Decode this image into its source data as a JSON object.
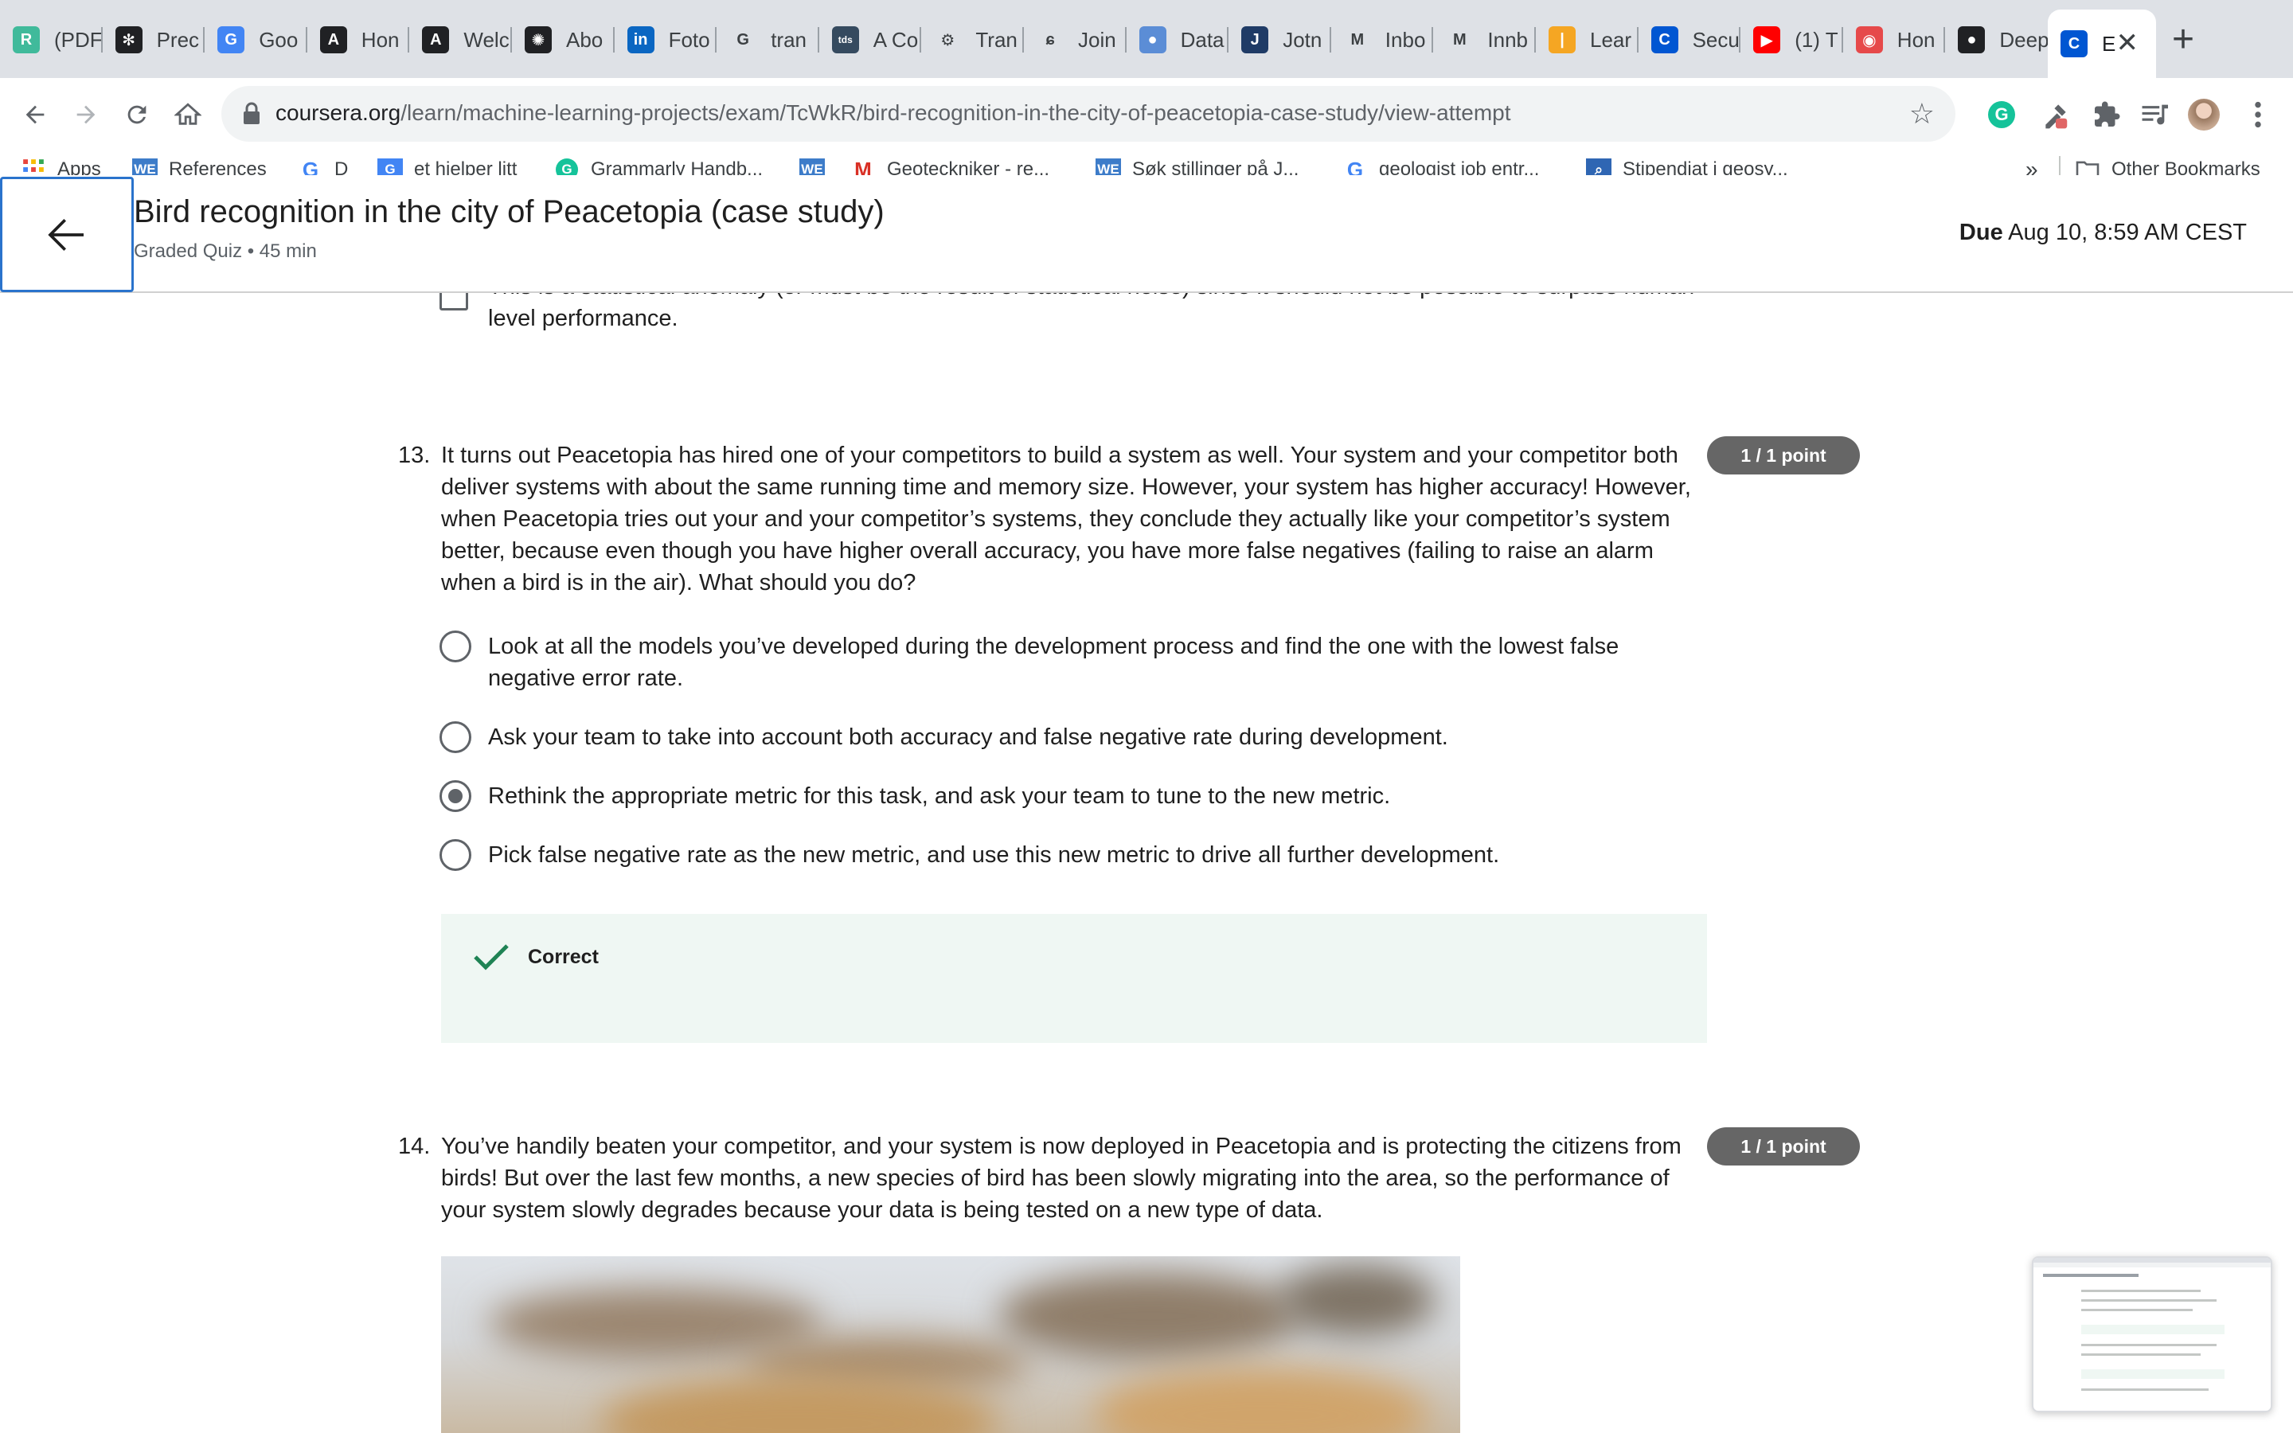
{
  "tabs": [
    {
      "label": "(PDF",
      "icon": "researchgate-icon",
      "color": "#40ba9b",
      "glyph": "R"
    },
    {
      "label": "Prec",
      "icon": "gear-icon",
      "color": "#202124",
      "glyph": "✻"
    },
    {
      "label": "Goo",
      "icon": "google-translate-icon",
      "color": "#4285f4",
      "glyph": "G"
    },
    {
      "label": "Hon",
      "icon": "letter-a-icon",
      "color": "#202124",
      "glyph": "A"
    },
    {
      "label": "Welc",
      "icon": "letter-a-icon",
      "color": "#202124",
      "glyph": "A"
    },
    {
      "label": "Abo",
      "icon": "openai-icon",
      "color": "#202124",
      "glyph": "✺"
    },
    {
      "label": "Foto",
      "icon": "linkedin-icon",
      "color": "#0a66c2",
      "glyph": "in"
    },
    {
      "label": "tran",
      "icon": "google-icon",
      "color": "#ffffff",
      "glyph": "G"
    },
    {
      "label": "A Co",
      "icon": "tds-icon",
      "color": "#354a5f",
      "glyph": "tds"
    },
    {
      "label": "Tran",
      "icon": "drone-icon",
      "color": "#ffffff",
      "glyph": "⚙"
    },
    {
      "label": "Join",
      "icon": "fork-icon",
      "color": "#ffffff",
      "glyph": "ɕ"
    },
    {
      "label": "Data",
      "icon": "person-icon",
      "color": "#5b8dd6",
      "glyph": "●"
    },
    {
      "label": "Jotn",
      "icon": "journal-icon",
      "color": "#1f3b66",
      "glyph": "J"
    },
    {
      "label": "Inbo",
      "icon": "gmail-icon",
      "color": "#ffffff",
      "glyph": "M"
    },
    {
      "label": "Innb",
      "icon": "gmail-icon",
      "color": "#ffffff",
      "glyph": "M"
    },
    {
      "label": "Lear",
      "icon": "bar-icon",
      "color": "#f5a623",
      "glyph": "|"
    },
    {
      "label": "Secu",
      "icon": "coursera-icon",
      "color": "#0056d2",
      "glyph": "C"
    },
    {
      "label": "(1) T",
      "icon": "youtube-icon",
      "color": "#ff0000",
      "glyph": "▶"
    },
    {
      "label": "Hon",
      "icon": "target-icon",
      "color": "#e6494a",
      "glyph": "◉"
    },
    {
      "label": "Deep",
      "icon": "github-icon",
      "color": "#202124",
      "glyph": "●"
    },
    {
      "label": "E",
      "icon": "coursera-icon",
      "color": "#0056d2",
      "glyph": "C"
    }
  ],
  "toolbar": {
    "url_host": "coursera.org",
    "url_path": "/learn/machine-learning-projects/exam/TcWkR/bird-recognition-in-the-city-of-peacetopia-case-study/view-attempt"
  },
  "bookmarks": {
    "items": [
      {
        "label": "Apps",
        "icon": "apps-grid-icon"
      },
      {
        "label": "References",
        "icon": "we-icon"
      },
      {
        "label": "D",
        "icon": "google-icon"
      },
      {
        "label": "et hjelper litt",
        "icon": "google-translate-icon"
      },
      {
        "label": "Grammarly Handb...",
        "icon": "grammarly-icon"
      },
      {
        "label": "",
        "icon": "we-icon"
      },
      {
        "label": "Geoteckniker - re...",
        "icon": "gmail-icon"
      },
      {
        "label": "Søk stillinger på J...",
        "icon": "we-icon"
      },
      {
        "label": "geologist job entr...",
        "icon": "google-icon"
      },
      {
        "label": "Stipendiat i geosy...",
        "icon": "bookmark-blue-icon"
      }
    ],
    "overflow": "»",
    "other": "Other Bookmarks"
  },
  "header": {
    "title": "Bird recognition in the city of Peacetopia (case study)",
    "subtitle": "Graded Quiz • 45 min",
    "due_label": "Due",
    "due_value": "Aug 10, 8:59 AM CEST"
  },
  "prev_option": {
    "text": "This is a statistical anomaly (or must be the result of statistical noise) since it should not be possible to surpass human-level performance."
  },
  "q13": {
    "number": "13.",
    "text": "It turns out Peacetopia has hired one of your competitors to build a system as well. Your system and your competitor both deliver systems with about the same running time and memory size. However, your system has higher accuracy! However, when Peacetopia tries out your and your competitor’s systems, they conclude they actually like your competitor’s system better, because even though you have higher overall accuracy, you have more false negatives (failing to raise an alarm when a bird is in the air). What should you do?",
    "points": "1 / 1 point",
    "options": [
      {
        "text": "Look at all the models you’ve developed during the development process and find the one with the lowest false negative error rate.",
        "selected": false
      },
      {
        "text": "Ask your team to take into account both accuracy and false negative rate during development.",
        "selected": false
      },
      {
        "text": "Rethink the appropriate metric for this task, and ask your team to tune to the new metric.",
        "selected": true
      },
      {
        "text": "Pick false negative rate as the new metric, and use this new metric to drive all further development.",
        "selected": false
      }
    ],
    "feedback": "Correct"
  },
  "q14": {
    "number": "14.",
    "text": "You’ve handily beaten your competitor, and your system is now deployed in Peacetopia and is protecting the citizens from birds! But over the last few months, a new species of bird has been slowly migrating into the area, so the performance of your system slowly degrades because your data is being tested on a new type of data.",
    "points": "1 / 1 point"
  },
  "colors": {
    "accent": "#2a73cc",
    "points_badge": "#666666",
    "correct_bg": "#eff7f3",
    "correct_check": "#1f8354"
  }
}
